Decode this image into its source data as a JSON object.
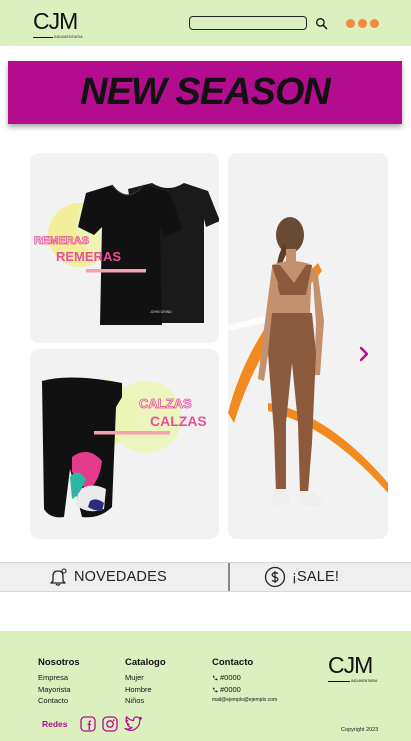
{
  "header": {
    "logo": "CJM",
    "logo_sub": "INDUMENTARIA",
    "search_placeholder": ""
  },
  "banner": {
    "title": "NEW SEASON"
  },
  "cards": {
    "remeras": {
      "label": "REMERAS"
    },
    "calzas": {
      "label": "CALZAS"
    },
    "tshirt_brand": "JOHN GRIND"
  },
  "bottom_nav": {
    "novedades": "NOVEDADES",
    "sale": "¡SALE!"
  },
  "footer": {
    "nosotros": {
      "title": "Nosotros",
      "items": [
        "Empresa",
        "Mayorista",
        "Contacto"
      ]
    },
    "catalogo": {
      "title": "Catalogo",
      "items": [
        "Mujer",
        "Hombre",
        "Niños"
      ]
    },
    "contacto": {
      "title": "Contacto",
      "phone1": "#0000",
      "phone2": "#0000",
      "email": "mail@ejemplo@ejemplo.com"
    },
    "redes_label": "Redes",
    "logo": "CJM",
    "logo_sub": "INDUMENTARIA",
    "copyright": "Copyright 2023"
  },
  "colors": {
    "header_bg": "#dcf0bf",
    "banner_bg": "#b30c8f",
    "accent_pink": "#e8509c",
    "accent_orange": "#f08a3c"
  },
  "icons": [
    "search-icon",
    "menu-dots-icon",
    "bell-icon",
    "dollar-icon",
    "chevron-right-icon",
    "phone-icon",
    "facebook-icon",
    "instagram-icon",
    "twitter-icon"
  ]
}
